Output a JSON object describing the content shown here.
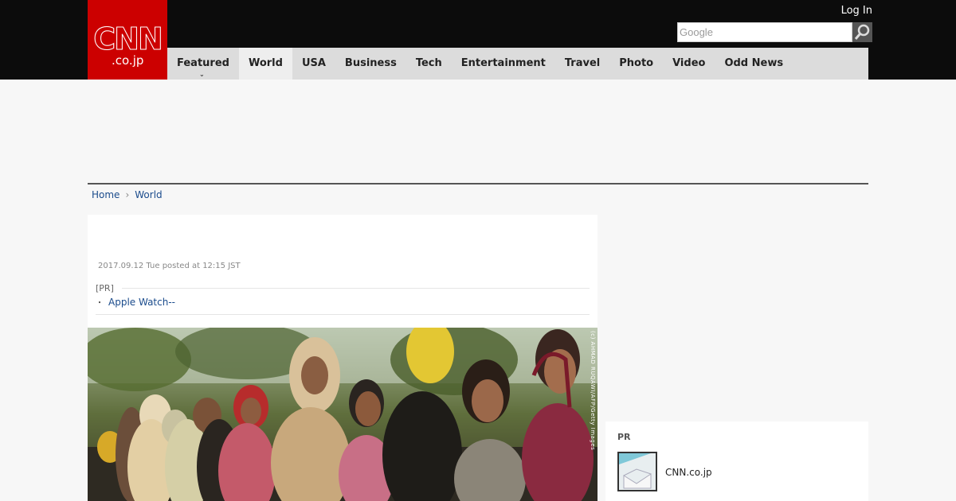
{
  "header": {
    "logo_main": "CNN",
    "logo_sub": ".co.jp",
    "login": "Log In",
    "search_placeholder": "Google"
  },
  "nav": {
    "items": [
      {
        "label": "Featured"
      },
      {
        "label": "World"
      },
      {
        "label": "USA"
      },
      {
        "label": "Business"
      },
      {
        "label": "Tech"
      },
      {
        "label": "Entertainment"
      },
      {
        "label": "Travel"
      },
      {
        "label": "Photo"
      },
      {
        "label": "Video"
      },
      {
        "label": "Odd News"
      }
    ],
    "active": "World"
  },
  "breadcrumb": {
    "home": "Home",
    "current": "World"
  },
  "article": {
    "date": "2017.09.12 Tue posted at 12:15 JST",
    "pr_label": "[PR]",
    "pr_bullet": "・",
    "pr_link": "Apple Watch--",
    "photo_credit": "(c) AHMAD RUQAWI/AFP/Getty Images"
  },
  "sidebar": {
    "label": "PR",
    "item_name": "CNN.co.jp"
  },
  "colors": {
    "brand_red": "#cc0000",
    "topbar": "#0c0c0c",
    "nav_bg": "#dcdcdc",
    "link": "#1a4b8c"
  }
}
